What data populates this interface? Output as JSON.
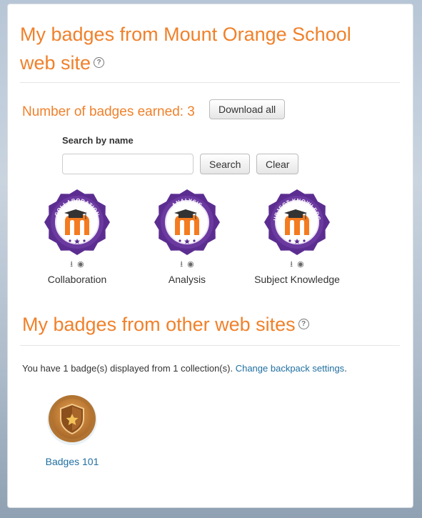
{
  "page": {
    "title": "My badges from Mount Orange School web site",
    "help_glyph": "?"
  },
  "local": {
    "earned_label": "Number of badges earned: 3",
    "download_all_label": "Download all",
    "search": {
      "label": "Search by name",
      "value": "",
      "placeholder": "",
      "search_button": "Search",
      "clear_button": "Clear"
    },
    "badges": [
      {
        "name": "Collaboration",
        "ribbon_text": "COLLABORATION",
        "icon": "moodle-badge-icon"
      },
      {
        "name": "Analysis",
        "ribbon_text": "ANALYSIS",
        "icon": "moodle-badge-icon"
      },
      {
        "name": "Subject Knowledge",
        "ribbon_text": "SUBJECT KNOWLEDGE",
        "icon": "moodle-badge-icon"
      }
    ],
    "badge_action_icons": [
      "download-icon",
      "eye-icon"
    ]
  },
  "external": {
    "title": "My badges from other web sites",
    "summary_text": "You have 1 badge(s) displayed from 1 collection(s).",
    "change_link": "Change backpack settings",
    "trailing_period": ".",
    "badges": [
      {
        "name": "Badges 101",
        "icon": "shield-star-icon"
      }
    ]
  },
  "colors": {
    "accent": "#f0812b",
    "link": "#1f6fa0",
    "badge_purple": "#5c2d91",
    "moodle_orange": "#f47b20",
    "bronze": "#c6873a"
  }
}
